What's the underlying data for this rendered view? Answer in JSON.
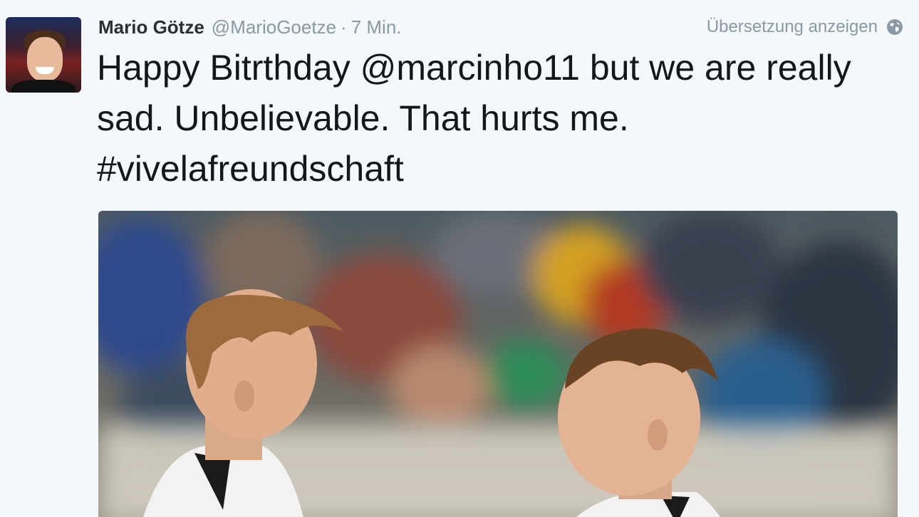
{
  "tweet": {
    "author_name": "Mario Götze",
    "author_handle": "@MarioGoetze",
    "separator": "·",
    "time": "7 Min.",
    "translate_label": "Übersetzung anzeigen",
    "text_before_mention": "Happy Bitrthday ",
    "mention": "@marcinho11",
    "text_after_mention": " but we are really sad. Unbelievable. That hurts me. ",
    "hashtag": "#vivelafreundschaft"
  },
  "icons": {
    "globe": "globe-icon"
  },
  "colors": {
    "name": "#292f33",
    "meta": "#8899a6",
    "text": "#14171a",
    "background": "#f5f8fa"
  }
}
